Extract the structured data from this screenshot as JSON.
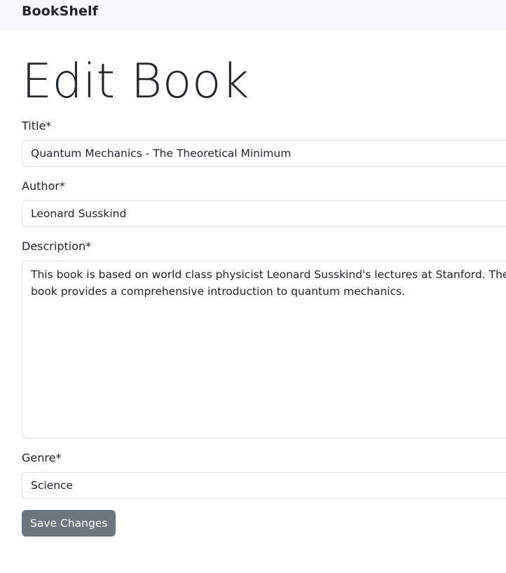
{
  "navbar": {
    "brand": "BookShelf"
  },
  "page": {
    "title": "Edit Book"
  },
  "form": {
    "title_label": "Title*",
    "title_value": "Quantum Mechanics - The Theoretical Minimum",
    "author_label": "Author*",
    "author_value": "Leonard Susskind",
    "description_label": "Description*",
    "description_value": "This book is based on world class physicist Leonard Susskind's lectures at Stanford. The book provides a comprehensive introduction to quantum mechanics.",
    "genre_label": "Genre*",
    "genre_value": "Science",
    "submit_label": "Save Changes"
  },
  "colors": {
    "navbar_bg": "#f8f9fa",
    "text": "#212529",
    "border": "#dee2e6",
    "button_bg": "#6c757d",
    "button_text": "#ffffff"
  }
}
